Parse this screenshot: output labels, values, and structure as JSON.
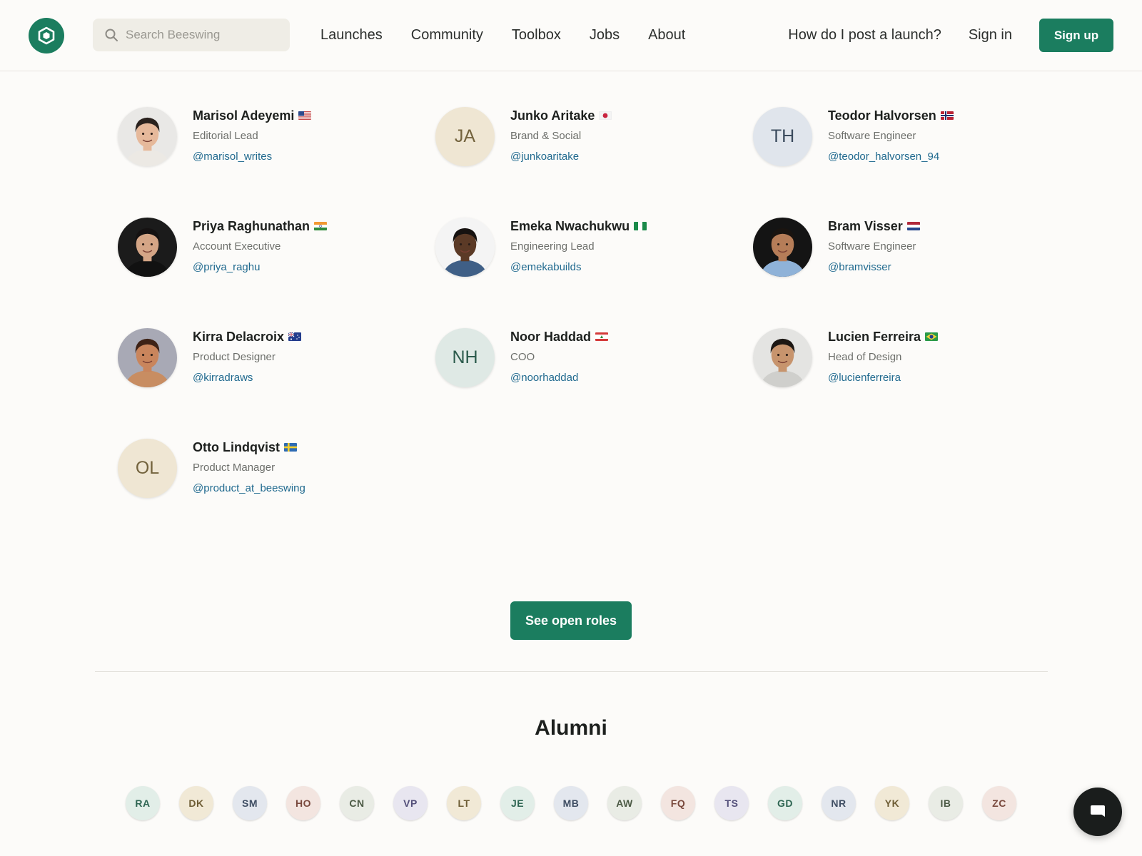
{
  "header": {
    "search_placeholder": "Search Beeswing",
    "nav": [
      "Launches",
      "Community",
      "Toolbox",
      "Jobs",
      "About"
    ],
    "help_link": "How do I post a launch?",
    "sign_in": "Sign in",
    "sign_up": "Sign up"
  },
  "colors": {
    "accent": "#1b7d5f",
    "link": "#216a8f"
  },
  "team": [
    {
      "name": "Marisol Adeyemi",
      "flag": "us",
      "role": "Editorial Lead",
      "handle": "@marisol_writes",
      "avatar": "photo",
      "photo": {
        "bg": "#e9e8e6",
        "skin": "#e6b99b",
        "hair": "#2a221e",
        "shirt": "#ece9e4"
      }
    },
    {
      "name": "Junko Aritake",
      "flag": "jp",
      "role": "Brand & Social",
      "handle": "@junkoaritake",
      "avatar": "initials",
      "initials": "JA",
      "bg": "#efe6d3",
      "fg": "#73633d"
    },
    {
      "name": "Teodor Halvorsen",
      "flag": "no",
      "role": "Software Engineer",
      "handle": "@teodor_halvorsen_94",
      "avatar": "initials",
      "initials": "TH",
      "bg": "#e0e5ec",
      "fg": "#3b4b5d"
    },
    {
      "name": "Priya Raghunathan",
      "flag": "in",
      "role": "Account Executive",
      "handle": "@priya_raghu",
      "avatar": "photo",
      "photo": {
        "bg": "#1b1b1b",
        "skin": "#d4a586",
        "hair": "#151212",
        "shirt": "#111111"
      }
    },
    {
      "name": "Emeka Nwachukwu",
      "flag": "ng",
      "role": "Engineering Lead",
      "handle": "@emekabuilds",
      "avatar": "photo",
      "photo": {
        "bg": "#f4f4f4",
        "skin": "#5b3a26",
        "hair": "#161210",
        "shirt": "#3f5f86"
      }
    },
    {
      "name": "Bram Visser",
      "flag": "nl",
      "role": "Software Engineer",
      "handle": "@bramvisser",
      "avatar": "photo",
      "photo": {
        "bg": "#141414",
        "skin": "#b67d58",
        "hair": "#1a1410",
        "shirt": "#8fb2d8"
      }
    },
    {
      "name": "Kirra Delacroix",
      "flag": "au",
      "role": "Product Designer",
      "handle": "@kirradraws",
      "avatar": "photo",
      "photo": {
        "bg": "#a8a9b5",
        "skin": "#c9855c",
        "hair": "#3d2216",
        "shirt": "#c88d62"
      }
    },
    {
      "name": "Noor Haddad",
      "flag": "lb",
      "role": "COO",
      "handle": "@noorhaddad",
      "avatar": "initials",
      "initials": "NH",
      "bg": "#dfe9e5",
      "fg": "#2c5b4c"
    },
    {
      "name": "Lucien Ferreira",
      "flag": "br",
      "role": "Head of Design",
      "handle": "@lucienferreira",
      "avatar": "photo",
      "photo": {
        "bg": "#e4e4e2",
        "skin": "#c7946d",
        "hair": "#1c1713",
        "shirt": "#cfcfcc"
      }
    },
    {
      "name": "Otto Lindqvist",
      "flag": "se",
      "role": "Product Manager",
      "handle": "@product_at_beeswing",
      "avatar": "initials",
      "initials": "OL",
      "bg": "#efe6d3",
      "fg": "#73633d"
    }
  ],
  "open_roles_button": "See open roles",
  "alumni_title": "Alumni",
  "alumni": [
    {
      "initials": "RA",
      "bg": "#e2eee8",
      "fg": "#2f6653"
    },
    {
      "initials": "DK",
      "bg": "#f1e9d6",
      "fg": "#6e5d35"
    },
    {
      "initials": "SM",
      "bg": "#e3e7ee",
      "fg": "#3f4e63"
    },
    {
      "initials": "HO",
      "bg": "#f3e5e0",
      "fg": "#7a4a3e"
    },
    {
      "initials": "CN",
      "bg": "#e9ece5",
      "fg": "#4c5a45"
    },
    {
      "initials": "VP",
      "bg": "#e8e6f0",
      "fg": "#54507a"
    },
    {
      "initials": "LT",
      "bg": "#f1e9d6",
      "fg": "#6e5d35"
    },
    {
      "initials": "JE",
      "bg": "#e2eee8",
      "fg": "#2f6653"
    },
    {
      "initials": "MB",
      "bg": "#e3e7ee",
      "fg": "#3f4e63"
    },
    {
      "initials": "AW",
      "bg": "#e9ece5",
      "fg": "#4c5a45"
    },
    {
      "initials": "FQ",
      "bg": "#f3e5e0",
      "fg": "#7a4a3e"
    },
    {
      "initials": "TS",
      "bg": "#e8e6f0",
      "fg": "#54507a"
    },
    {
      "initials": "GD",
      "bg": "#e2eee8",
      "fg": "#2f6653"
    },
    {
      "initials": "NR",
      "bg": "#e3e7ee",
      "fg": "#3f4e63"
    },
    {
      "initials": "YK",
      "bg": "#f1e9d6",
      "fg": "#6e5d35"
    },
    {
      "initials": "IB",
      "bg": "#e9ece5",
      "fg": "#4c5a45"
    },
    {
      "initials": "ZC",
      "bg": "#f3e5e0",
      "fg": "#7a4a3e"
    }
  ],
  "icons": {
    "logo": "hexagon-logo-icon",
    "search": "search-icon",
    "chat": "chat-bubble-icon"
  }
}
